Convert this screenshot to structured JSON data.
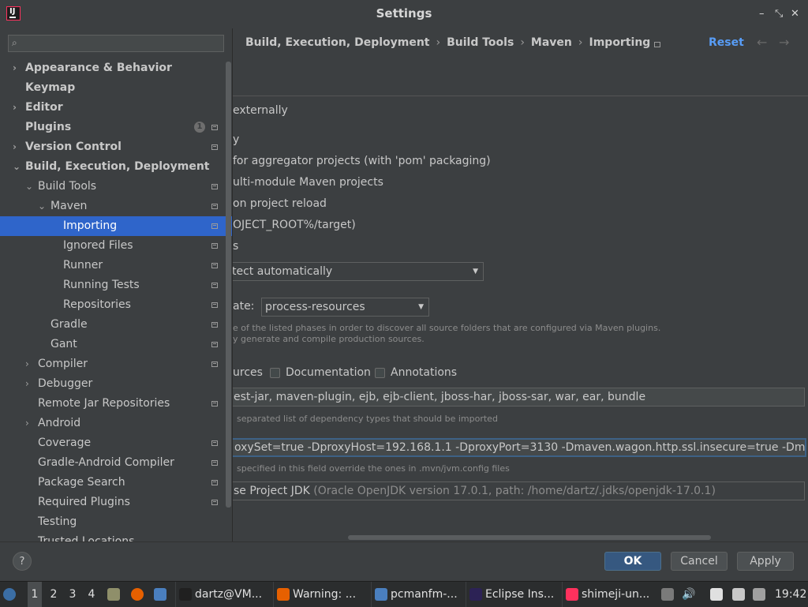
{
  "window": {
    "title": "Settings",
    "min": "–",
    "restore": "⤡",
    "close": "✕",
    "app_icon_text": "IJ"
  },
  "sidebar": {
    "search_placeholder": "",
    "items": [
      {
        "label": "Appearance & Behavior",
        "arrow": "›",
        "bold": true
      },
      {
        "label": "Keymap",
        "bold": true
      },
      {
        "label": "Editor",
        "arrow": "›",
        "bold": true
      },
      {
        "label": "Plugins",
        "bold": true,
        "badge": "1"
      },
      {
        "label": "Version Control",
        "arrow": "›",
        "bold": true
      },
      {
        "label": "Build, Execution, Deployment",
        "arrow": "⌄",
        "bold": true
      },
      {
        "label": "Build Tools",
        "arrow": "⌄"
      },
      {
        "label": "Maven",
        "arrow": "⌄"
      },
      {
        "label": "Importing",
        "selected": true
      },
      {
        "label": "Ignored Files"
      },
      {
        "label": "Runner"
      },
      {
        "label": "Running Tests"
      },
      {
        "label": "Repositories"
      },
      {
        "label": "Gradle"
      },
      {
        "label": "Gant"
      },
      {
        "label": "Compiler",
        "arrow": "›"
      },
      {
        "label": "Debugger",
        "arrow": "›"
      },
      {
        "label": "Remote Jar Repositories"
      },
      {
        "label": "Android",
        "arrow": "›"
      },
      {
        "label": "Coverage"
      },
      {
        "label": "Gradle-Android Compiler"
      },
      {
        "label": "Package Search"
      },
      {
        "label": "Required Plugins"
      },
      {
        "label": "Testing"
      },
      {
        "label": "Trusted Locations"
      }
    ]
  },
  "main": {
    "breadcrumb": [
      "Build, Execution, Deployment",
      "Build Tools",
      "Maven",
      "Importing"
    ],
    "separator": "›",
    "reset": "Reset",
    "nav_back": "←",
    "nav_forward": "→",
    "lines": {
      "externally": "externally",
      "y": "y",
      "aggregator": "for aggregator projects (with 'pom' packaging)",
      "multimodule": "ulti-module Maven projects",
      "reload": "on project reload",
      "target": "OJECT_ROOT%/target)",
      "s": "s",
      "detect": "tect automatically",
      "phase_label": "ate:",
      "phase_value": "process-resources",
      "phase_hint_1": "e of the listed phases in order to discover all source folders that are configured via Maven plugins.",
      "phase_hint_2": "y generate and compile production sources.",
      "sources": "urces",
      "documentation": "Documentation",
      "annotations": "Annotations",
      "dep_types": "est-jar, maven-plugin, ejb, ejb-client, jboss-har, jboss-sar, war, ear, bundle",
      "dep_hint": "separated list of dependency types that should be imported",
      "vm_options": "oxySet=true -DproxyHost=192.168.1.1 -DproxyPort=3130 -Dmaven.wagon.http.ssl.insecure=true -Dmaven.wag",
      "vm_hint": "specified in this field override the ones in .mvn/jvm.config files",
      "jdk_value": "se Project JDK",
      "jdk_detail": "(Oracle OpenJDK version 17.0.1, path: /home/dartz/.jdks/openjdk-17.0.1)"
    }
  },
  "footer": {
    "help": "?",
    "ok": "OK",
    "cancel": "Cancel",
    "apply": "Apply"
  },
  "taskbar": {
    "workspaces": [
      "1",
      "2",
      "3",
      "4"
    ],
    "tasks": [
      {
        "label": "dartz@VM...",
        "color": "#202020"
      },
      {
        "label": "Warning: ...",
        "color": "#e66000"
      },
      {
        "label": "pcmanfm-...",
        "color": "#4a7fbf"
      },
      {
        "label": "Eclipse Ins...",
        "color": "#2c2255"
      },
      {
        "label": "shimeji-un...",
        "color": "#fe315d"
      }
    ],
    "clock": "19:42"
  }
}
